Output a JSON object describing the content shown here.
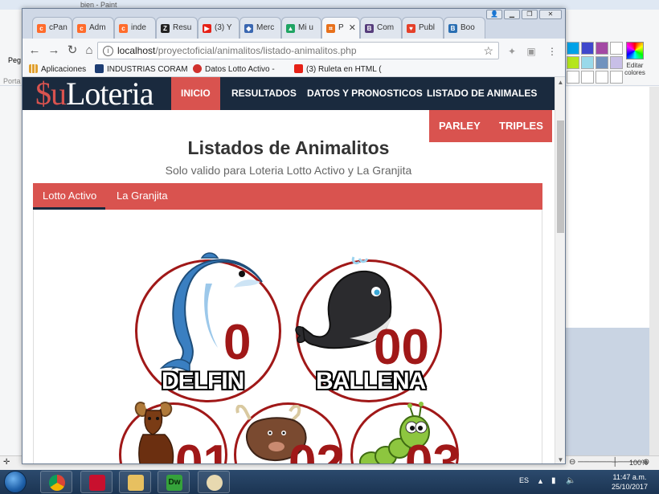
{
  "paint": {
    "title": "bien - Paint",
    "left_labels": [
      "Peg",
      "Porta"
    ],
    "edit_colors": "Editar colores",
    "zoom": "100%",
    "palette": [
      "#00a2e8",
      "#3f48cc",
      "#a349a4",
      "#ffffff",
      "#b5e61d",
      "#99d9ea",
      "#7092be",
      "#c8bfe7",
      "#ffffff",
      "#ffffff",
      "#ffffff",
      "#ffffff"
    ]
  },
  "chrome": {
    "tabs": [
      {
        "label": "cPan",
        "color": "#ff6c2c",
        "icon": "cP"
      },
      {
        "label": "Adm",
        "color": "#ff6c2c",
        "icon": "cP"
      },
      {
        "label": "inde",
        "color": "#ff6c2c",
        "icon": "cP"
      },
      {
        "label": "Resu",
        "color": "#222222",
        "icon": "Z"
      },
      {
        "label": "(3) Y",
        "color": "#e62117",
        "icon": "▶"
      },
      {
        "label": "Merc",
        "color": "#3a67b1",
        "icon": "◆"
      },
      {
        "label": "Mi u",
        "color": "#1fa463",
        "icon": "▲"
      },
      {
        "label": "P",
        "color": "#e8711c",
        "icon": "⌗"
      },
      {
        "label": "Com",
        "color": "#563d7c",
        "icon": "B"
      },
      {
        "label": "Publ",
        "color": "#e5402a",
        "icon": "♥"
      },
      {
        "label": "Boo",
        "color": "#2a6fb3",
        "icon": "B"
      }
    ],
    "active_tab_index": 7,
    "url_host": "localhost",
    "url_path": "/proyectoficial/animalitos/listado-animalitos.php",
    "bookmarks": [
      {
        "label": "Aplicaciones",
        "color": "#e0a030"
      },
      {
        "label": "INDUSTRIAS CORAM",
        "color": "#1d3d73"
      },
      {
        "label": "Datos Lotto Activo -",
        "color": "#d0312d"
      },
      {
        "label": "(3) Ruleta en HTML (",
        "color": "#e62117"
      }
    ]
  },
  "site": {
    "logo_dollar": "$",
    "logo_u": "u",
    "logo_text": "Loteria",
    "nav": [
      "INICIO",
      "RESULTADOS",
      "DATOS Y PRONOSTICOS",
      "LISTADO DE ANIMALES"
    ],
    "subnav": [
      "PARLEY",
      "TRIPLES"
    ],
    "title": "Listados de Animalitos",
    "subtitle": "Solo valido para Loteria Lotto Activo y La Granjita",
    "tabs": [
      "Lotto Activo",
      "La Granjita"
    ],
    "animals": [
      {
        "num": "0",
        "name": "DELFIN"
      },
      {
        "num": "00",
        "name": "BALLENA"
      },
      {
        "num": "01",
        "name": ""
      },
      {
        "num": "02",
        "name": ""
      },
      {
        "num": "03",
        "name": ""
      }
    ]
  },
  "taskbar": {
    "lang": "ES",
    "time": "11:47 a.m.",
    "date": "25/10/2017"
  }
}
